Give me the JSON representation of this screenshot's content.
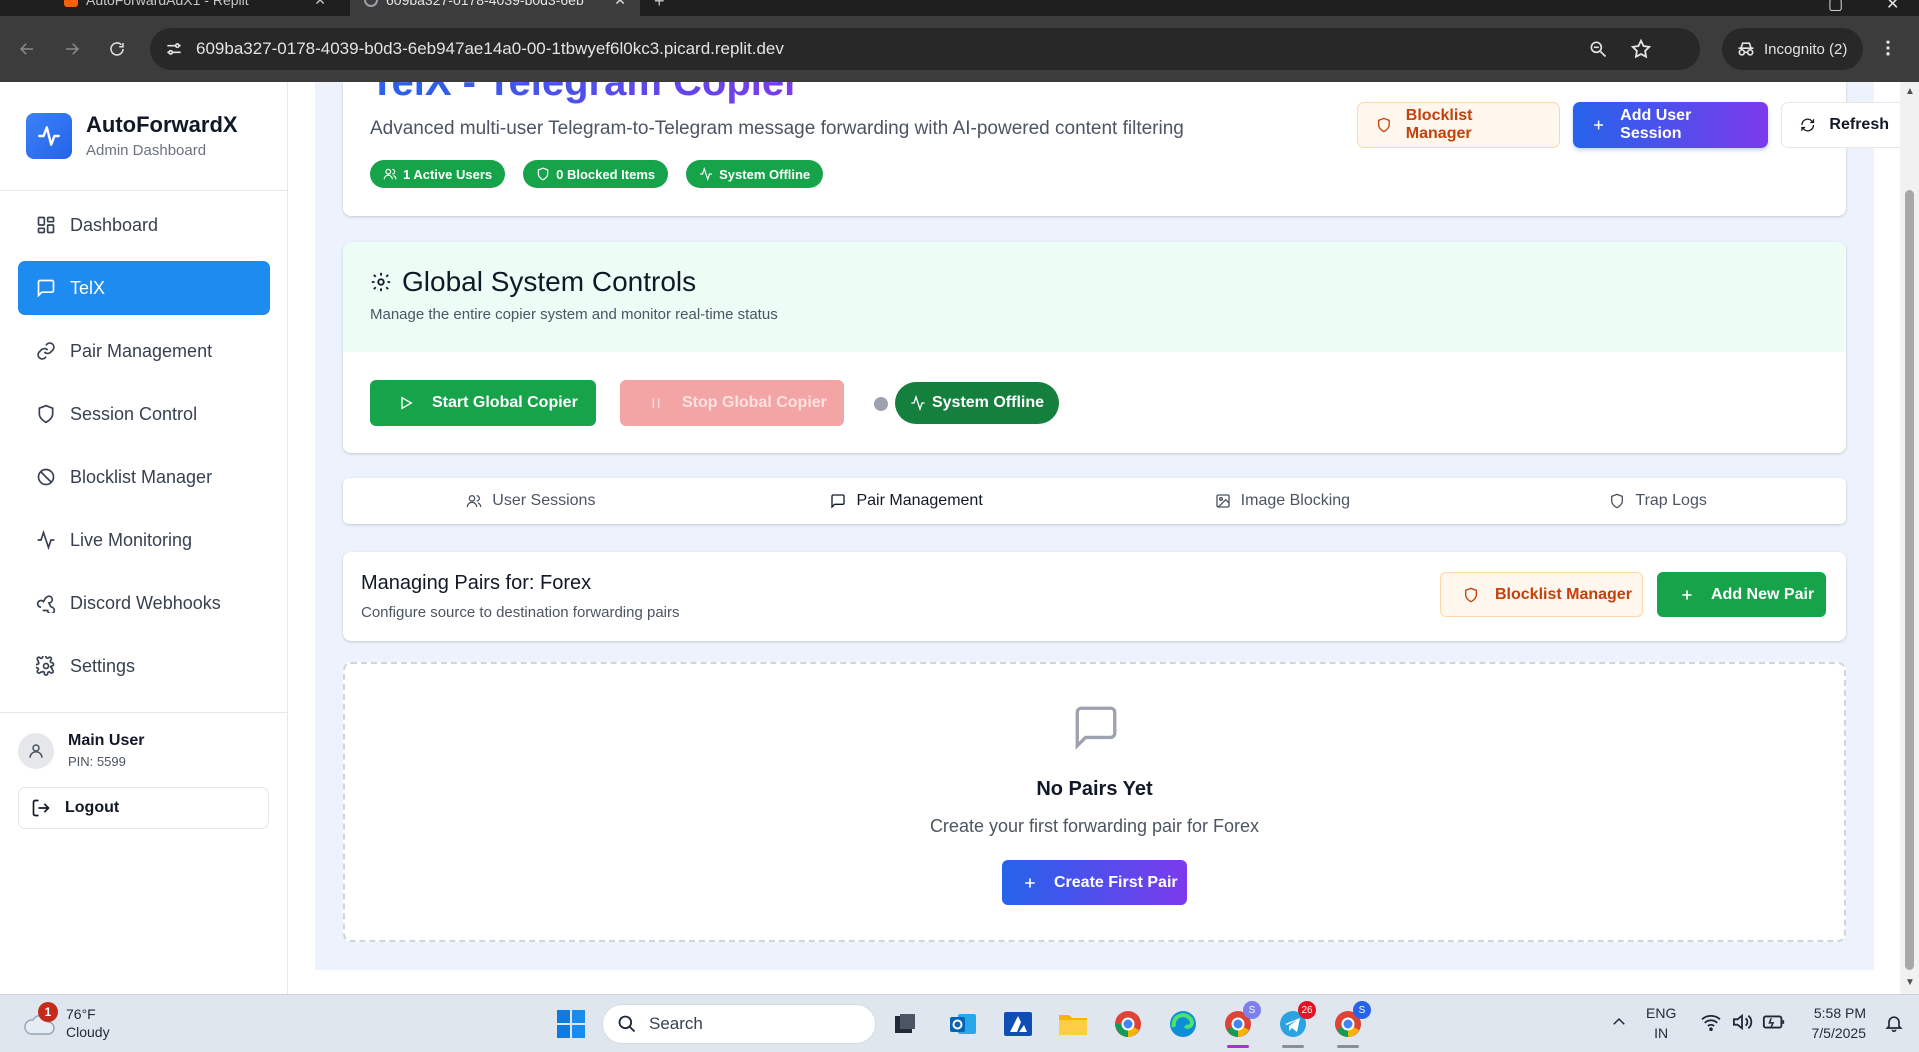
{
  "browser": {
    "tabs": [
      {
        "title": "AutoForwardAdX1 - Replit",
        "active": false
      },
      {
        "title": "609ba327-0178-4039-b0d3-6eb",
        "active": true
      }
    ],
    "url": "609ba327-0178-4039-b0d3-6eb947ae14a0-00-1tbwyef6l0kc3.picard.replit.dev",
    "incognito_label": "Incognito (2)"
  },
  "sidebar": {
    "app_name": "AutoForwardX",
    "app_subtitle": "Admin Dashboard",
    "items": [
      {
        "label": "Dashboard",
        "icon": "layout-grid-icon",
        "active": false
      },
      {
        "label": "TelX",
        "icon": "message-square-icon",
        "active": true
      },
      {
        "label": "Pair Management",
        "icon": "link-icon",
        "active": false
      },
      {
        "label": "Session Control",
        "icon": "shield-icon",
        "active": false
      },
      {
        "label": "Blocklist Manager",
        "icon": "ban-icon",
        "active": false
      },
      {
        "label": "Live Monitoring",
        "icon": "activity-icon",
        "active": false
      },
      {
        "label": "Discord Webhooks",
        "icon": "webhook-icon",
        "active": false
      },
      {
        "label": "Settings",
        "icon": "gear-icon",
        "active": false
      }
    ],
    "user": {
      "name": "Main User",
      "pin": "PIN: 5599"
    },
    "logout_label": "Logout"
  },
  "header": {
    "title": "TelX - Telegram Copier",
    "subtitle": "Advanced multi-user Telegram-to-Telegram message forwarding with AI-powered content filtering",
    "badges": [
      "1 Active Users",
      "0 Blocked Items",
      "System Offline"
    ],
    "blocklist_label": "Blocklist Manager",
    "add_session_label": "Add User Session",
    "refresh_label": "Refresh"
  },
  "global_controls": {
    "title": "Global System Controls",
    "subtitle": "Manage the entire copier system and monitor real-time status",
    "start_label": "Start Global Copier",
    "stop_label": "Stop Global Copier",
    "status_label": "System Offline"
  },
  "tabs": [
    {
      "label": "User Sessions",
      "icon": "users-icon",
      "active": false
    },
    {
      "label": "Pair Management",
      "icon": "message-square-icon",
      "active": true
    },
    {
      "label": "Image Blocking",
      "icon": "image-icon",
      "active": false
    },
    {
      "label": "Trap Logs",
      "icon": "shield-icon",
      "active": false
    }
  ],
  "pairs": {
    "title": "Managing Pairs for: Forex",
    "subtitle": "Configure source to destination forwarding pairs",
    "blocklist_label": "Blocklist Manager",
    "add_label": "Add New Pair",
    "empty_title": "No Pairs Yet",
    "empty_subtitle": "Create your first forwarding pair for Forex",
    "create_label": "Create First Pair"
  },
  "taskbar": {
    "weather_temp": "76°F",
    "weather_desc": "Cloudy",
    "weather_badge": "1",
    "search_placeholder": "Search",
    "telegram_badge": "26",
    "chrome_badge": "S",
    "lang_line1": "ENG",
    "lang_line2": "IN",
    "time": "5:58 PM",
    "date": "7/5/2025"
  },
  "colors": {
    "primary": "#1d8bf0",
    "success": "#16a34a",
    "gradient_start": "#2563eb",
    "gradient_end": "#7c3aed",
    "warning_text": "#c2410c"
  }
}
